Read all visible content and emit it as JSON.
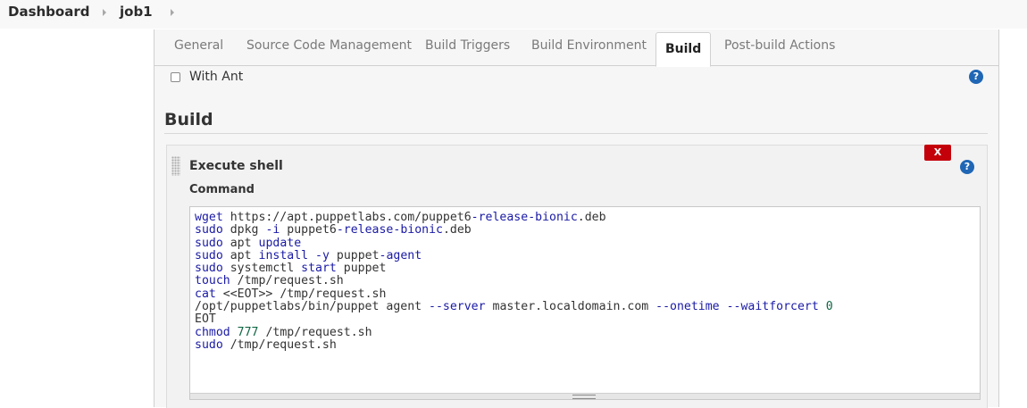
{
  "breadcrumb": {
    "items": [
      {
        "label": "Dashboard"
      },
      {
        "label": "job1"
      }
    ]
  },
  "tabs": [
    {
      "label": "General",
      "active": false
    },
    {
      "label": "Source Code Management",
      "active": false
    },
    {
      "label": "Build Triggers",
      "active": false
    },
    {
      "label": "Build Environment",
      "active": false
    },
    {
      "label": "Build",
      "active": true
    },
    {
      "label": "Post-build Actions",
      "active": false
    }
  ],
  "with_ant": {
    "label": "With Ant",
    "checked": false
  },
  "help_icon_glyph": "?",
  "build_section": {
    "title": "Build"
  },
  "execute_shell": {
    "title": "Execute shell",
    "delete_label": "X",
    "command_label": "Command",
    "command_lines": [
      "wget https://apt.puppetlabs.com/puppet6-release-bionic.deb",
      "sudo dpkg -i puppet6-release-bionic.deb",
      "sudo apt update",
      "sudo apt install -y puppet-agent",
      "sudo systemctl start puppet",
      "touch /tmp/request.sh",
      "cat <<EOT>> /tmp/request.sh",
      "/opt/puppetlabs/bin/puppet agent --server master.localdomain.com --onetime --waitforcert 0",
      "EOT",
      "chmod 777 /tmp/request.sh",
      "sudo /tmp/request.sh"
    ]
  },
  "colors": {
    "active_tab_bg": "#ffffff",
    "help_icon": "#1f66b5",
    "delete_button": "#c4000a",
    "code_keyword": "#1a1aa6"
  },
  "icons": {
    "help": "help-icon",
    "breadcrumb_separator": "chevron-right-icon",
    "drag": "drag-handle-icon"
  }
}
